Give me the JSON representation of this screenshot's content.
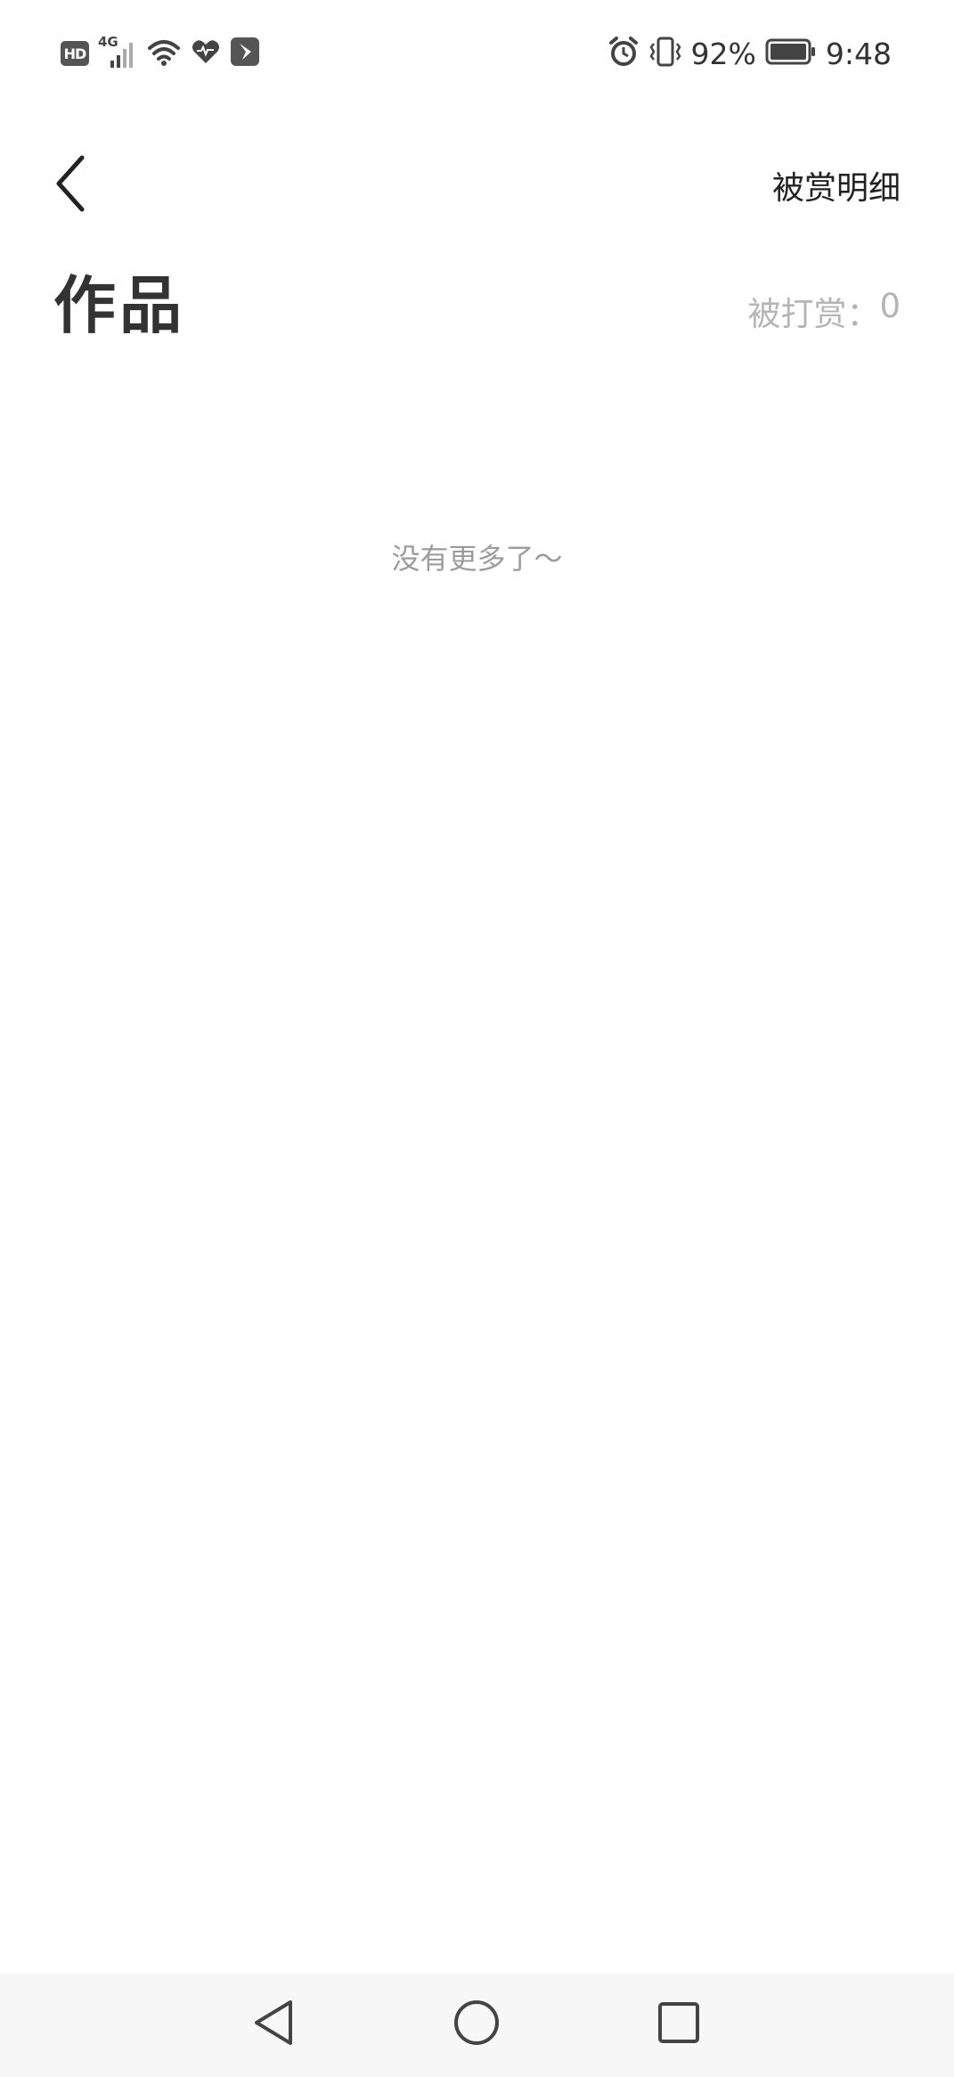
{
  "status_bar": {
    "hd_label": "HD",
    "network_label": "4G",
    "battery_percent": "92%",
    "time": "9:48",
    "icons": [
      "hd-icon",
      "signal-icon",
      "wifi-icon",
      "health-icon",
      "app-notification-icon",
      "alarm-icon",
      "vibrate-icon",
      "battery-icon"
    ]
  },
  "header": {
    "back_icon": "chevron-left-icon",
    "detail_link_label": "被赏明细"
  },
  "main": {
    "title": "作品",
    "reward_label": "被打赏：",
    "reward_value": "0",
    "empty_message": "没有更多了～"
  },
  "nav_bar": {
    "icons": [
      "back-triangle-icon",
      "home-circle-icon",
      "recents-square-icon"
    ]
  },
  "colors": {
    "title": "#333333",
    "muted": "#b5b5b5",
    "empty_text": "#9c9c9c",
    "nav_bg": "#f7f7f7"
  }
}
